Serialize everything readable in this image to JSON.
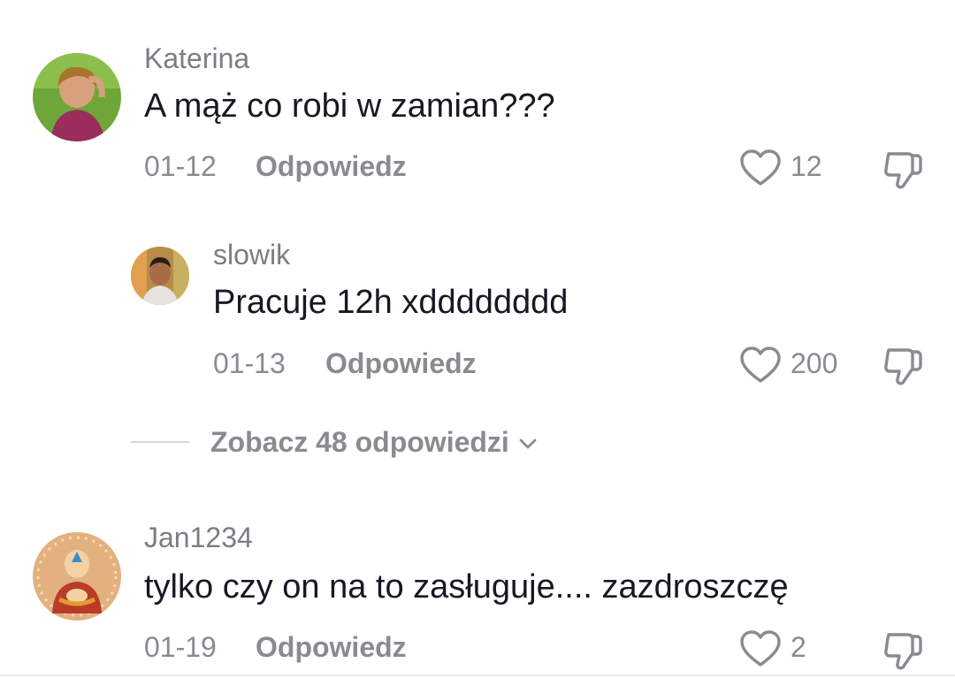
{
  "colors": {
    "text_primary": "#161823",
    "text_secondary": "#8a8b91",
    "username": "#7c7d83"
  },
  "comments": [
    {
      "username": "Katerina",
      "text": "A mąż co robi w zamian???",
      "date": "01-12",
      "reply_label": "Odpowiedz",
      "likes": "12",
      "avatar": "profile-photo-woman"
    },
    {
      "username": "slowik",
      "text": "Pracuje 12h xdddddddd",
      "date": "01-13",
      "reply_label": "Odpowiedz",
      "likes": "200",
      "avatar": "profile-photo-man"
    },
    {
      "username": "Jan1234",
      "text": "tylko czy on na to zasługuje.... zazdroszczę",
      "date": "01-19",
      "reply_label": "Odpowiedz",
      "likes": "2",
      "avatar": "cartoon-monk-avatar"
    }
  ],
  "view_replies": {
    "label": "Zobacz 48 odpowiedzi"
  },
  "icons": {
    "like": "heart-outline-icon",
    "dislike": "thumbs-down-outline-icon",
    "expand": "chevron-down-icon"
  }
}
